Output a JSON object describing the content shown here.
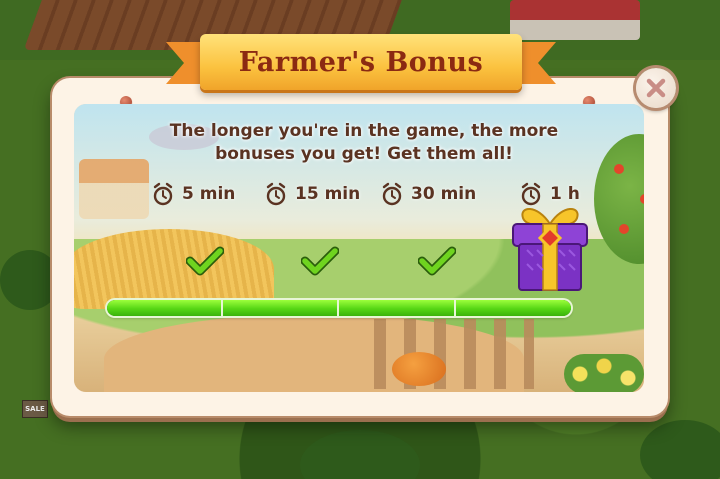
{
  "dialog": {
    "title": "Farmer's Bonus",
    "message": "The longer you're in the game, the more bonuses you get! Get them all!",
    "close_icon": "close-x-icon"
  },
  "milestones": [
    {
      "label": "5 min",
      "claimed": true,
      "icon": "alarm-clock-icon"
    },
    {
      "label": "15 min",
      "claimed": true,
      "icon": "alarm-clock-icon"
    },
    {
      "label": "30 min",
      "claimed": true,
      "icon": "alarm-clock-icon"
    },
    {
      "label": "1 h",
      "claimed": false,
      "icon": "alarm-clock-icon",
      "reward_icon": "gift-box-icon"
    }
  ],
  "progress": {
    "fraction": 1.0
  },
  "background": {
    "sign_text": "SALE"
  },
  "colors": {
    "ribbon": "#fbc23f",
    "title_text": "#8b2a12",
    "body_text": "#5a3322",
    "progress_fill": "#56d615",
    "check": "#5fc81a",
    "gift": "#7b32c4",
    "gift_ribbon": "#f7c52a"
  }
}
